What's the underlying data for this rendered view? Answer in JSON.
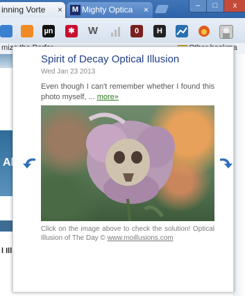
{
  "tabs": [
    {
      "label": "inning Vorte",
      "close": "×"
    },
    {
      "label": "Mighty Optica",
      "close": "×",
      "favicon": "M"
    }
  ],
  "window_controls": {
    "minimize": "–",
    "maximize": "□",
    "close": "x"
  },
  "toolbar": {
    "extensions": [
      {
        "icon": "monitor-icon",
        "text": ""
      },
      {
        "icon": "chart-icon",
        "text": ""
      },
      {
        "icon": "ufo-icon",
        "text": "µn"
      },
      {
        "icon": "lastpass-icon",
        "text": "✱"
      },
      {
        "icon": "w-icon",
        "text": "W"
      },
      {
        "icon": "signal-icon",
        "text": ""
      },
      {
        "icon": "badge-icon",
        "text": "0"
      },
      {
        "icon": "h-icon",
        "text": "H"
      },
      {
        "icon": "graph-icon",
        "text": ""
      },
      {
        "icon": "fox-icon",
        "text": ""
      },
      {
        "icon": "profile-icon",
        "text": ""
      }
    ]
  },
  "bookmarks_bar": {
    "left_item": "mize the Perfor",
    "right_item": "Other bookma"
  },
  "background_page": {
    "banner_text": "Al",
    "side_text": "l Ill"
  },
  "popup": {
    "title": "Spirit of Decay Optical Illusion",
    "date": "Wed Jan 23 2013",
    "excerpt": "Even though I can't remember whether I found this photo myself, ...",
    "more_link": "more»",
    "caption": "Click on the image above to check the solution! Optical Illusion of The Day © ",
    "caption_link": "www.moillusions.com"
  },
  "colors": {
    "title": "#1f3f86",
    "more_link": "#2d7a1e",
    "nav_arrow": "#2f6fb5"
  }
}
